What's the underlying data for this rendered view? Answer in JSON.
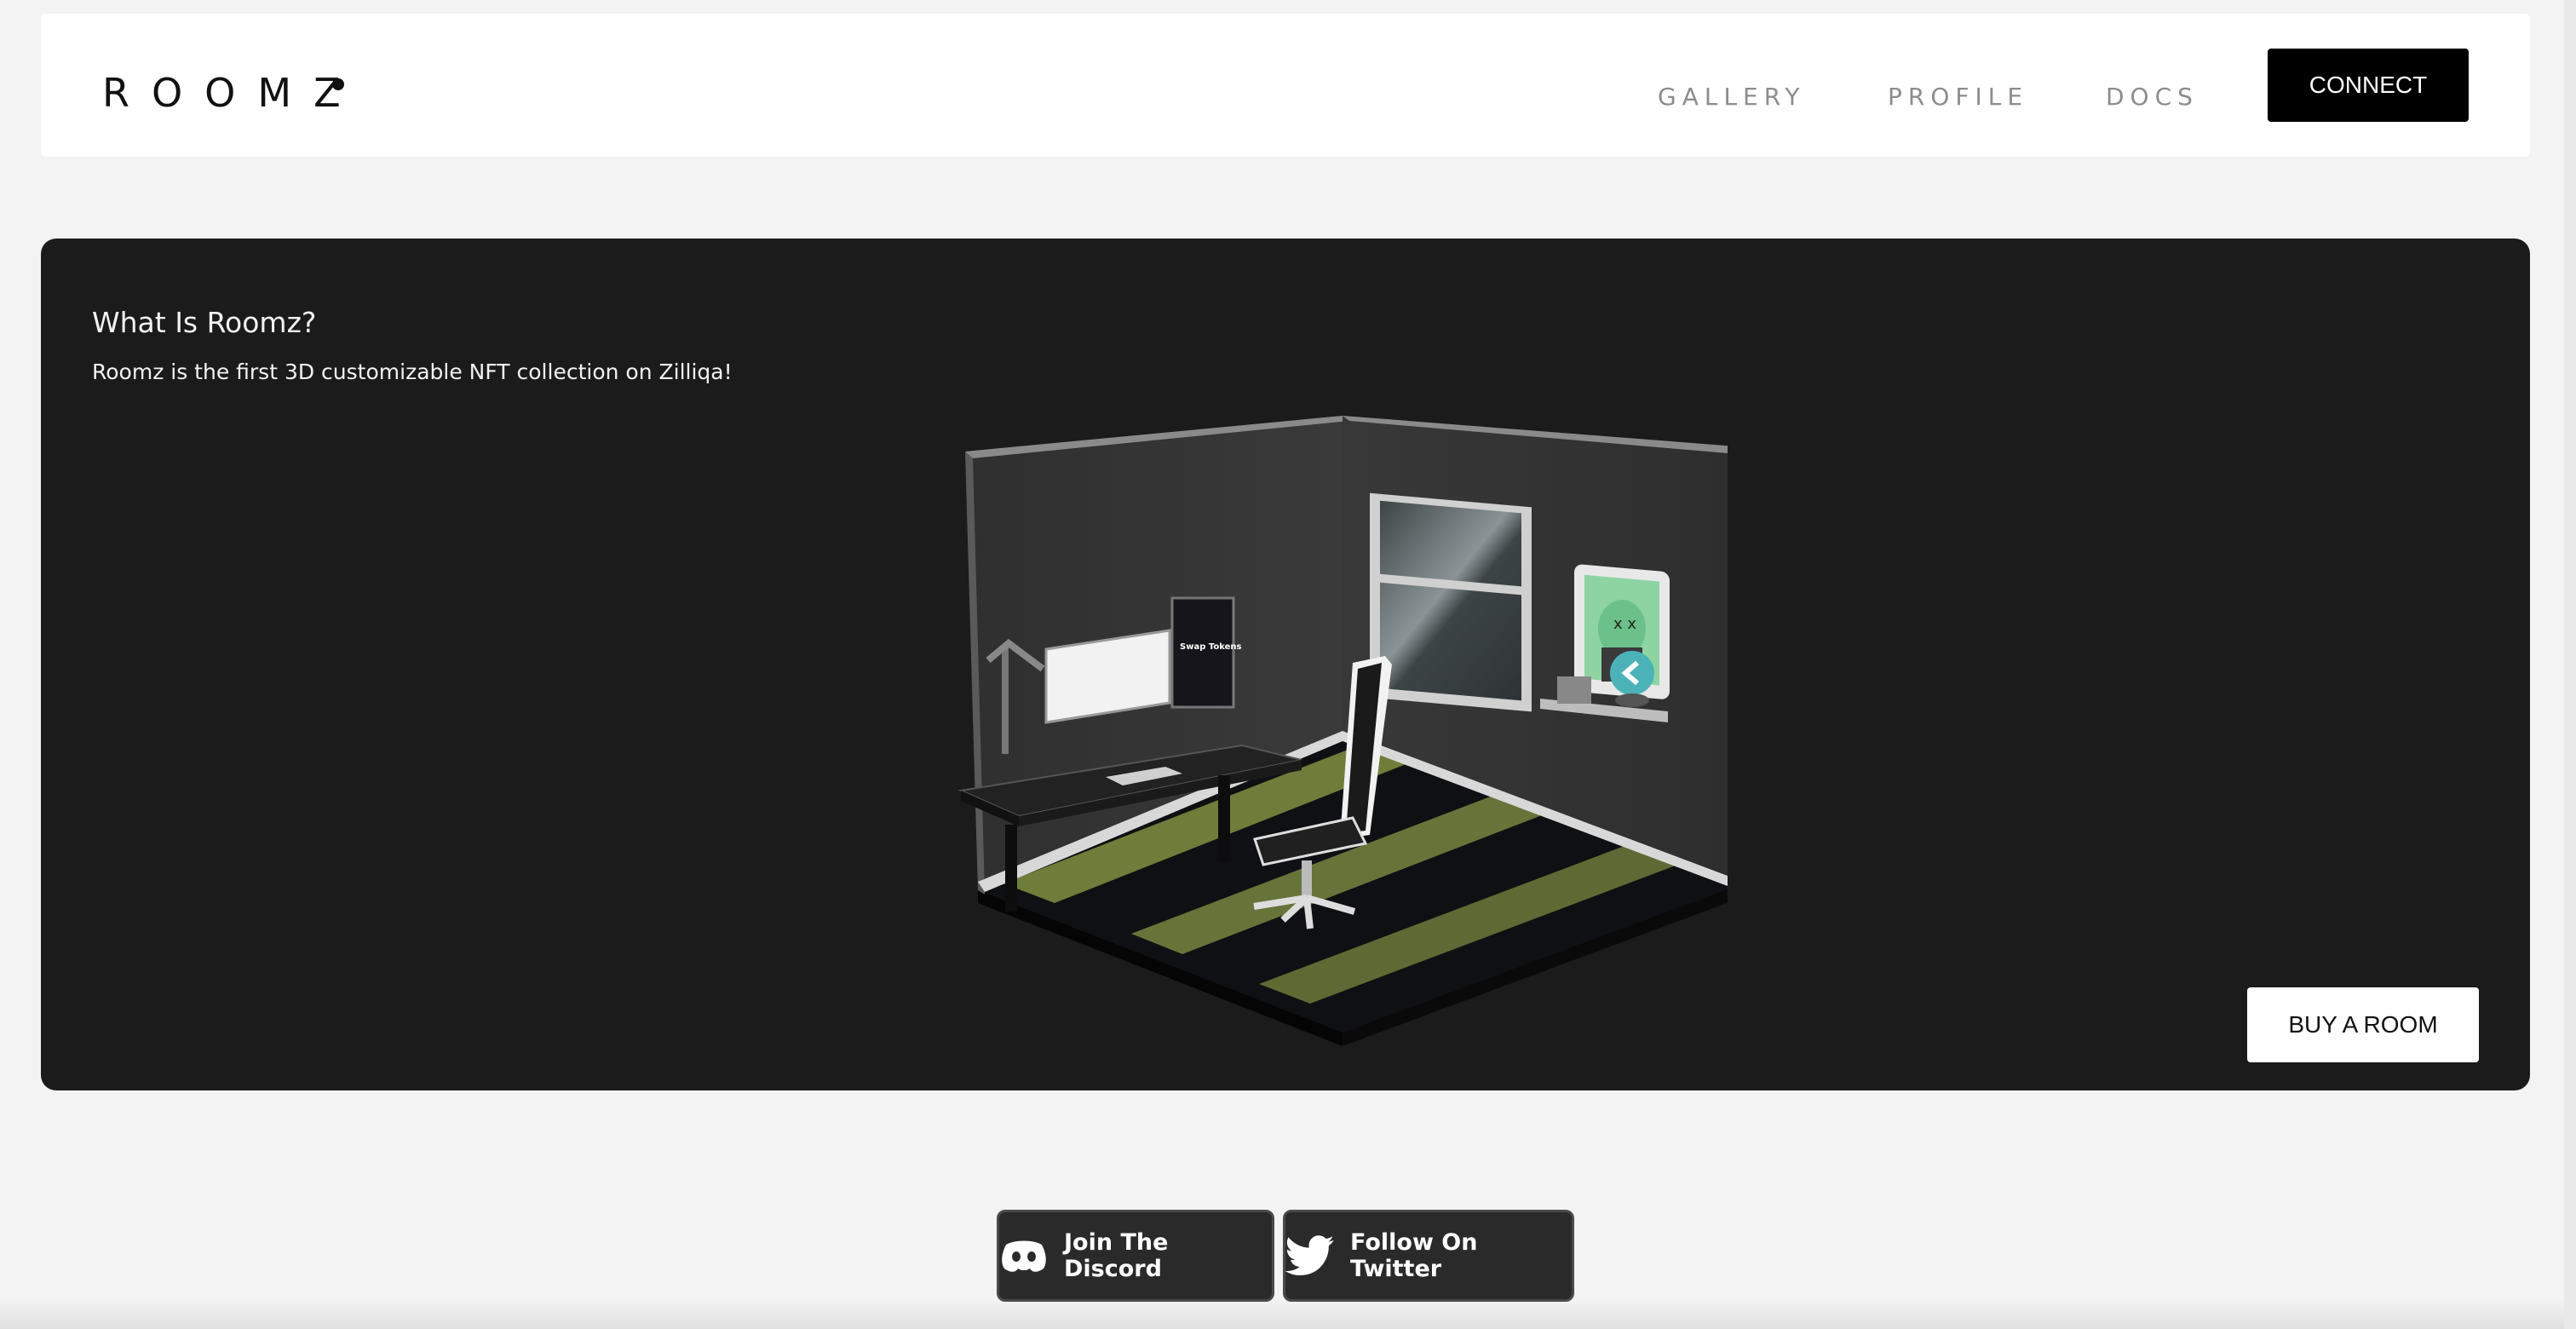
{
  "header": {
    "logo": "ROOMZ",
    "nav": [
      {
        "label": "GALLERY"
      },
      {
        "label": "PROFILE"
      },
      {
        "label": "DOCS"
      }
    ],
    "connect_label": "CONNECT"
  },
  "hero": {
    "title": "What Is Roomz?",
    "subtitle": "Roomz is the first 3D customizable NFT collection on Zilliqa!",
    "buy_label": "BUY A ROOM",
    "screen_text": "Swap Tokens",
    "colors": {
      "background": "#1b1b1b",
      "floor_stripe": "#6f7d3a",
      "wall": "#333333"
    }
  },
  "social": {
    "discord_label": "Join The Discord",
    "discord_icon": "discord-icon",
    "twitter_label": "Follow On Twitter",
    "twitter_icon": "twitter-icon"
  }
}
